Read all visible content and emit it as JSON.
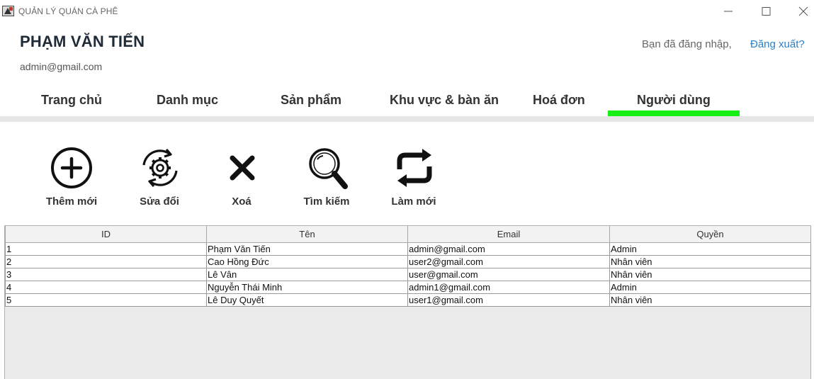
{
  "window": {
    "title": "QUẢN LÝ QUÁN CÀ PHÊ",
    "icons": [
      "app-icon",
      "minimize-icon",
      "maximize-icon",
      "close-icon"
    ]
  },
  "header": {
    "user_name": "PHẠM VĂN TIẾN",
    "user_email": "admin@gmail.com",
    "login_text": "Bạn đã đăng nhập,",
    "logout_label": "Đăng xuất?"
  },
  "nav": {
    "tabs": [
      {
        "label": "Trang chủ"
      },
      {
        "label": "Danh mục"
      },
      {
        "label": "Sản phẩm"
      },
      {
        "label": "Khu vực & bàn ăn"
      },
      {
        "label": "Hoá đơn"
      },
      {
        "label": "Người dùng"
      }
    ],
    "active": "Người dùng",
    "active_color": "#16f016"
  },
  "toolbar": {
    "add_label": "Thêm mới",
    "edit_label": "Sửa đổi",
    "delete_label": "Xoá",
    "search_label": "Tìm kiếm",
    "refresh_label": "Làm mới"
  },
  "table": {
    "columns": [
      "ID",
      "Tên",
      "Email",
      "Quyền"
    ],
    "rows": [
      [
        "1",
        "Phạm Văn Tiến",
        "admin@gmail.com",
        "Admin"
      ],
      [
        "2",
        "Cao Hồng Đức",
        "user2@gmail.com",
        "Nhân viên"
      ],
      [
        "3",
        "Lê Vân",
        "user@gmail.com",
        "Nhân viên"
      ],
      [
        "4",
        "Nguyễn Thái Minh",
        "admin1@gmail.com",
        "Admin"
      ],
      [
        "5",
        "Lê Duy Quyết",
        "user1@gmail.com",
        "Nhân viên"
      ]
    ]
  }
}
